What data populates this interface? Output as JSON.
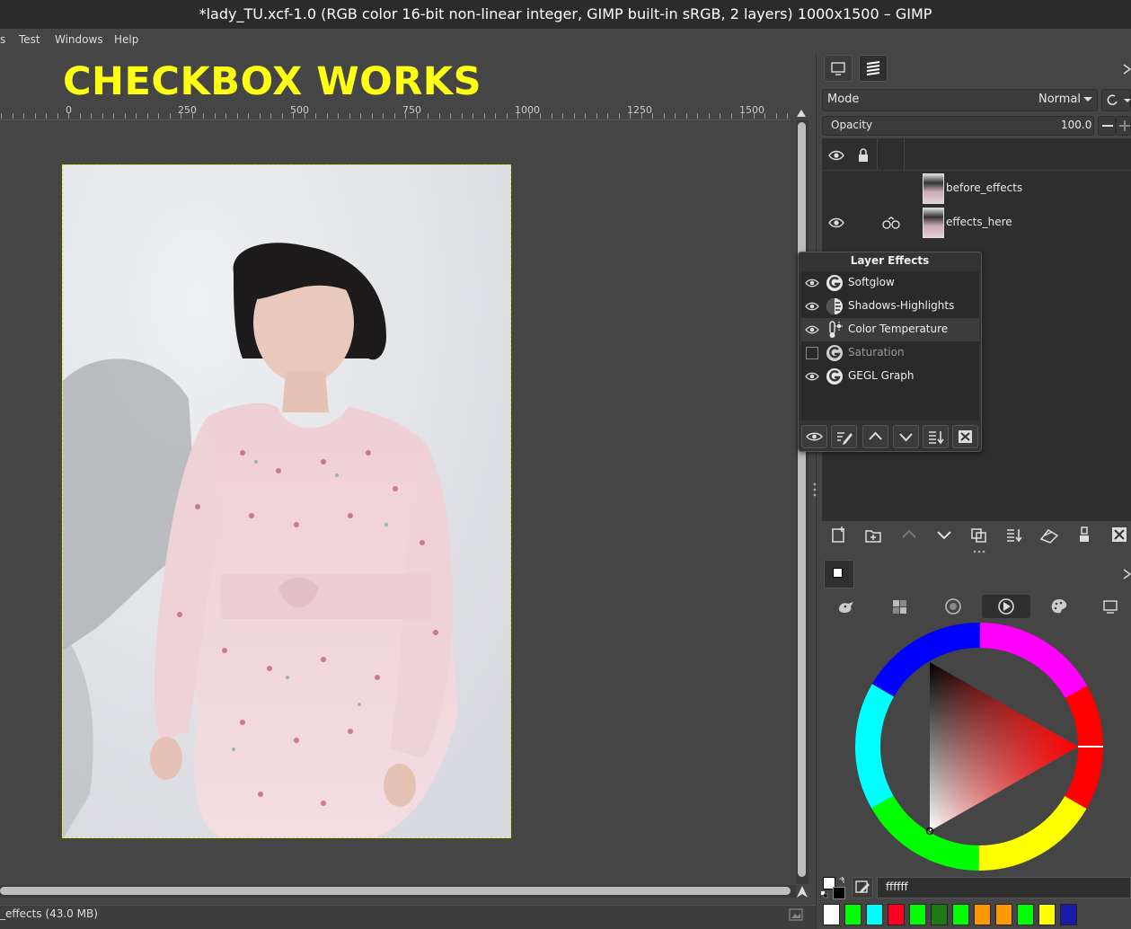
{
  "window": {
    "title": "*lady_TU.xcf-1.0 (RGB color 16-bit non-linear integer, GIMP built-in sRGB, 2 layers) 1000x1500 – GIMP"
  },
  "menu": {
    "items": [
      "s",
      "Test",
      "Windows",
      "Help"
    ]
  },
  "overlay": {
    "text": "CHECKBOX WORKS",
    "color": "#ffff14"
  },
  "ruler": {
    "labels": [
      "0",
      "250",
      "500",
      "750",
      "1000",
      "1250",
      "1500"
    ]
  },
  "status": {
    "text": "_effects (43.0 MB)"
  },
  "layers_panel": {
    "mode_label": "Mode",
    "mode_value": "Normal",
    "opacity_label": "Opacity",
    "opacity_value": "100.0",
    "layers": [
      {
        "name": "before_effects",
        "visible": false,
        "has_effects": false
      },
      {
        "name": "effects_here",
        "visible": true,
        "has_effects": true
      }
    ]
  },
  "layer_effects": {
    "title": "Layer Effects",
    "effects": [
      {
        "name": "Softglow",
        "enabled": true,
        "icon": "gegl-icon"
      },
      {
        "name": "Shadows-Highlights",
        "enabled": true,
        "icon": "shadows-highlights-icon"
      },
      {
        "name": "Color Temperature",
        "enabled": true,
        "icon": "thermometer-icon",
        "selected": true
      },
      {
        "name": "Saturation",
        "enabled": false,
        "icon": "gegl-icon"
      },
      {
        "name": "GEGL Graph",
        "enabled": true,
        "icon": "gegl-icon"
      }
    ]
  },
  "colors": {
    "hex_value": "ffffff",
    "palette": [
      "#ffffff",
      "#00ff00",
      "#00ffff",
      "#ff0022",
      "#00ff00",
      "#1e7a12",
      "#00ff00",
      "#ff9900",
      "#ff9900",
      "#00ff00",
      "#ffff00",
      "#1a1aa8"
    ]
  }
}
